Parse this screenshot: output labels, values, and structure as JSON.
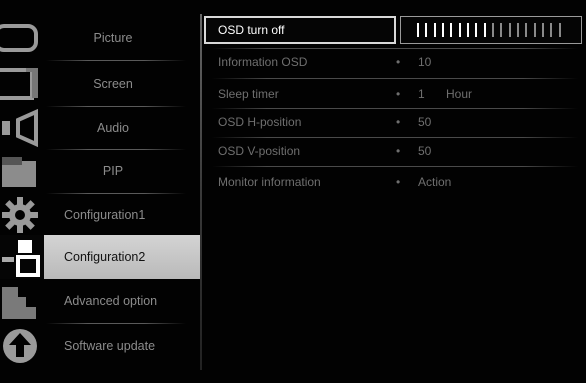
{
  "sidebar": {
    "items": [
      {
        "label": "Picture",
        "icon": "picture-icon"
      },
      {
        "label": "Screen",
        "icon": "screen-icon"
      },
      {
        "label": "Audio",
        "icon": "speaker-icon"
      },
      {
        "label": "PIP",
        "icon": "pip-icon"
      },
      {
        "label": "Configuration1",
        "icon": "gear-icon"
      },
      {
        "label": "Configuration2",
        "icon": "configuration-icon"
      },
      {
        "label": "Advanced option",
        "icon": "stairs-icon"
      },
      {
        "label": "Software update",
        "icon": "upload-arrow-icon"
      }
    ],
    "active_index": 5
  },
  "menu": {
    "rows": [
      {
        "name": "OSD turn off",
        "value": "",
        "unit": ""
      },
      {
        "name": "Information OSD",
        "value": "10",
        "unit": ""
      },
      {
        "name": "Sleep timer",
        "value": "1",
        "unit": "Hour"
      },
      {
        "name": "OSD H-position",
        "value": "50",
        "unit": ""
      },
      {
        "name": "OSD V-position",
        "value": "50",
        "unit": ""
      },
      {
        "name": "Monitor information",
        "value": "Action",
        "unit": ""
      }
    ],
    "dot": "•",
    "osd_turn_off_level": 0.5,
    "slider_ticks": 18
  },
  "colors": {
    "active_bg": "#c8c8c8",
    "selected_border": "#d8d8d8",
    "tick_on": "#ffffff",
    "tick_off": "#8a8a8a"
  }
}
